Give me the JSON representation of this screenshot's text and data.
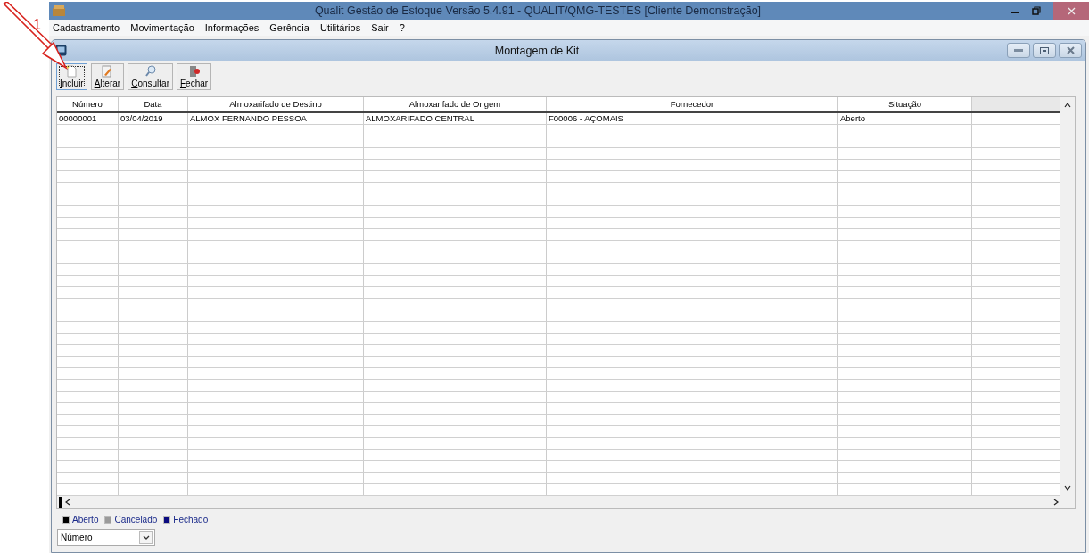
{
  "annotation": {
    "label": "1"
  },
  "window": {
    "title": "Qualit Gestão de Estoque Versão 5.4.91 - QUALIT/QMG-TESTES [Cliente Demonstração]"
  },
  "menu": [
    "Cadastramento",
    "Movimentação",
    "Informações",
    "Gerência",
    "Utilitários",
    "Sair",
    "?"
  ],
  "child_window": {
    "title": "Montagem de Kit"
  },
  "toolbar": [
    {
      "label": "Incluir",
      "kind": "new",
      "selected": true
    },
    {
      "label": "Alterar",
      "kind": "edit",
      "selected": false
    },
    {
      "label": "Consultar",
      "kind": "search",
      "selected": false
    },
    {
      "label": "Fechar",
      "kind": "exit",
      "selected": false
    }
  ],
  "table": {
    "columns": [
      "Número",
      "Data",
      "Almoxarifado de Destino",
      "Almoxarifado de Origem",
      "Fornecedor",
      "Situação"
    ],
    "rows": [
      [
        "00000001",
        "03/04/2019",
        "ALMOX FERNANDO PESSOA",
        "ALMOXARIFADO CENTRAL",
        "F00006 - AÇOMAIS",
        "Aberto"
      ]
    ]
  },
  "legend": [
    {
      "label": "Aberto",
      "color": "#000000"
    },
    {
      "label": "Cancelado",
      "color": "#9a9a9a"
    },
    {
      "label": "Fechado",
      "color": "#0a0a80"
    }
  ],
  "sort_select": {
    "value": "Número"
  }
}
